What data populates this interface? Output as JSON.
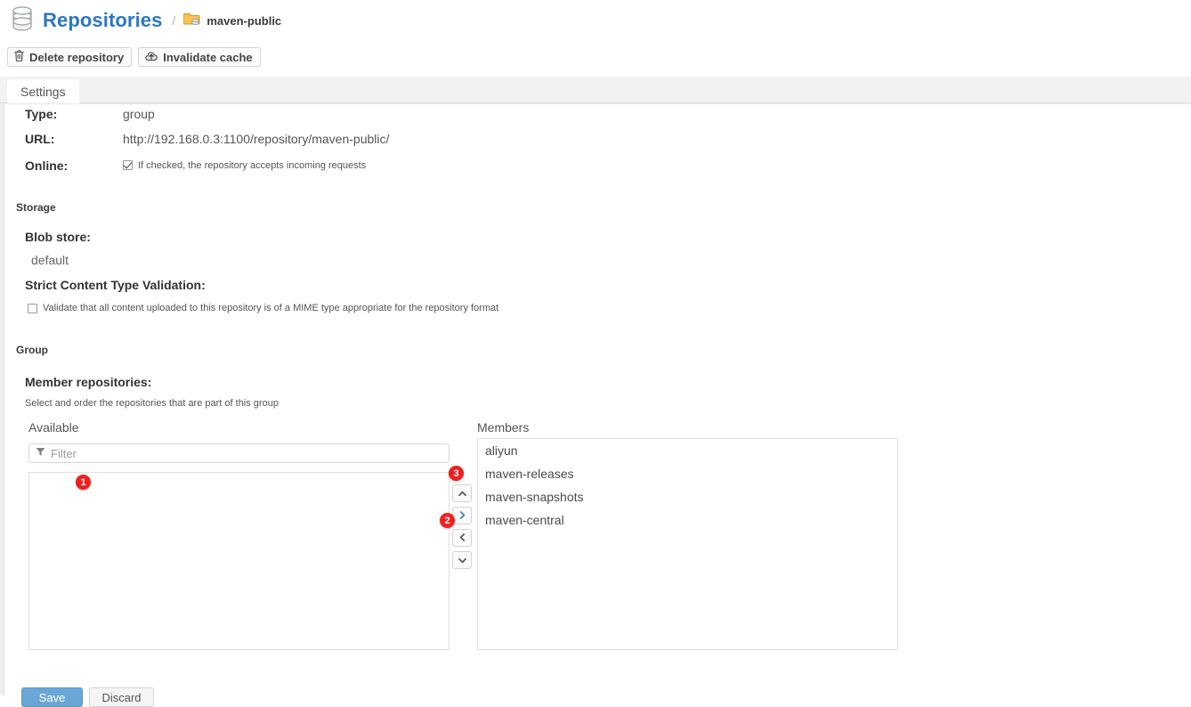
{
  "header": {
    "icon": "database-icon",
    "title": "Repositories",
    "separator": "/",
    "breadcrumb_icon": "repository-group-icon",
    "current": "maven-public"
  },
  "toolbar": {
    "delete_label": "Delete repository",
    "delete_icon": "trash-icon",
    "invalidate_label": "Invalidate cache",
    "invalidate_icon": "cloud-upload-icon"
  },
  "tabs": [
    {
      "label": "Settings",
      "active": true
    }
  ],
  "settings": {
    "type_label": "Type:",
    "type_value": "group",
    "url_label": "URL:",
    "url_value": "http://192.168.0.3:1100/repository/maven-public/",
    "online_label": "Online:",
    "online_checked": true,
    "online_hint": "If checked, the repository accepts incoming requests"
  },
  "storage": {
    "section_title": "Storage",
    "blob_store_label": "Blob store:",
    "blob_store_value": "default",
    "strict_label": "Strict Content Type Validation:",
    "strict_checked": false,
    "strict_hint": "Validate that all content uploaded to this repository is of a MIME type appropriate for the repository format"
  },
  "group": {
    "section_title": "Group",
    "member_label": "Member repositories:",
    "member_hint": "Select and order the repositories that are part of this group",
    "available_heading": "Available",
    "members_heading": "Members",
    "filter_placeholder": "Filter",
    "filter_value": "",
    "filter_icon": "funnel-icon",
    "available_items": [],
    "members_items": [
      "aliyun",
      "maven-releases",
      "maven-snapshots",
      "maven-central"
    ],
    "transfer_buttons": [
      {
        "name": "move-up-button",
        "icon": "chevron-up-icon"
      },
      {
        "name": "add-button",
        "icon": "chevron-right-icon"
      },
      {
        "name": "remove-button",
        "icon": "chevron-left-icon"
      },
      {
        "name": "move-down-button",
        "icon": "chevron-down-icon"
      }
    ]
  },
  "annotations": [
    {
      "id": "1",
      "label": "1",
      "target": "available-list"
    },
    {
      "id": "2",
      "label": "2",
      "target": "add-button"
    },
    {
      "id": "3",
      "label": "3",
      "target": "move-up-button"
    }
  ],
  "footer": {
    "save_label": "Save",
    "discard_label": "Discard"
  },
  "colors": {
    "accent": "#2b77c4",
    "badge": "#f02020",
    "primary_button": "#6aa6d6"
  }
}
